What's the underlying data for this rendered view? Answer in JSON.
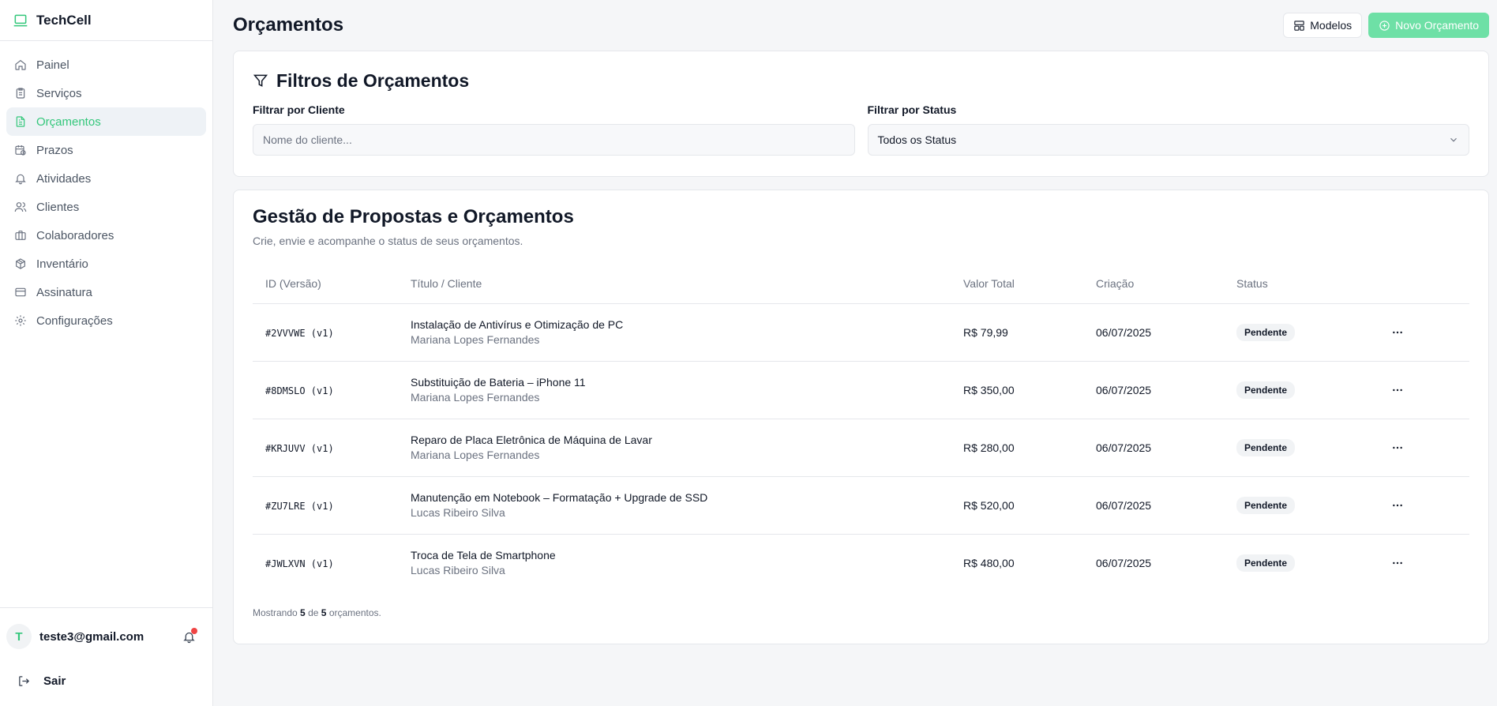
{
  "app": {
    "name": "TechCell"
  },
  "sidebar": {
    "items": [
      {
        "label": "Painel",
        "icon": "home-icon"
      },
      {
        "label": "Serviços",
        "icon": "clipboard-icon"
      },
      {
        "label": "Orçamentos",
        "icon": "file-text-icon",
        "active": true
      },
      {
        "label": "Prazos",
        "icon": "calendar-clock-icon"
      },
      {
        "label": "Atividades",
        "icon": "bell-icon"
      },
      {
        "label": "Clientes",
        "icon": "users-icon"
      },
      {
        "label": "Colaboradores",
        "icon": "briefcase-icon"
      },
      {
        "label": "Inventário",
        "icon": "package-icon"
      },
      {
        "label": "Assinatura",
        "icon": "credit-card-icon"
      },
      {
        "label": "Configurações",
        "icon": "gear-icon"
      }
    ],
    "user": {
      "initial": "T",
      "email": "teste3@gmail.com"
    },
    "logout_label": "Sair"
  },
  "header": {
    "title": "Orçamentos",
    "templates_label": "Modelos",
    "new_quote_label": "Novo Orçamento"
  },
  "filters": {
    "title": "Filtros de Orçamentos",
    "client_label": "Filtrar por Cliente",
    "client_placeholder": "Nome do cliente...",
    "status_label": "Filtrar por Status",
    "status_value": "Todos os Status"
  },
  "quotes": {
    "title": "Gestão de Propostas e Orçamentos",
    "subtitle": "Crie, envie e acompanhe o status de seus orçamentos.",
    "columns": [
      "ID (Versão)",
      "Título / Cliente",
      "Valor Total",
      "Criação",
      "Status"
    ],
    "rows": [
      {
        "id": "#2VVVWE (v1)",
        "title": "Instalação de Antivírus e Otimização de PC",
        "client": "Mariana Lopes Fernandes",
        "value": "R$ 79,99",
        "date": "06/07/2025",
        "status": "Pendente"
      },
      {
        "id": "#8DMSLO (v1)",
        "title": "Substituição de Bateria – iPhone 11",
        "client": "Mariana Lopes Fernandes",
        "value": "R$ 350,00",
        "date": "06/07/2025",
        "status": "Pendente"
      },
      {
        "id": "#KRJUVV (v1)",
        "title": "Reparo de Placa Eletrônica de Máquina de Lavar",
        "client": "Mariana Lopes Fernandes",
        "value": "R$ 280,00",
        "date": "06/07/2025",
        "status": "Pendente"
      },
      {
        "id": "#ZU7LRE (v1)",
        "title": "Manutenção em Notebook – Formatação + Upgrade de SSD",
        "client": "Lucas Ribeiro Silva",
        "value": "R$ 520,00",
        "date": "06/07/2025",
        "status": "Pendente"
      },
      {
        "id": "#JWLXVN (v1)",
        "title": "Troca de Tela de Smartphone",
        "client": "Lucas Ribeiro Silva",
        "value": "R$ 480,00",
        "date": "06/07/2025",
        "status": "Pendente"
      }
    ],
    "footer": {
      "prefix": "Mostrando",
      "shown": "5",
      "middle": "de",
      "total": "5",
      "suffix": "orçamentos."
    }
  },
  "colors": {
    "accent": "#34c77b",
    "accent_light": "#6ee0a6",
    "notification": "#ef4444"
  }
}
